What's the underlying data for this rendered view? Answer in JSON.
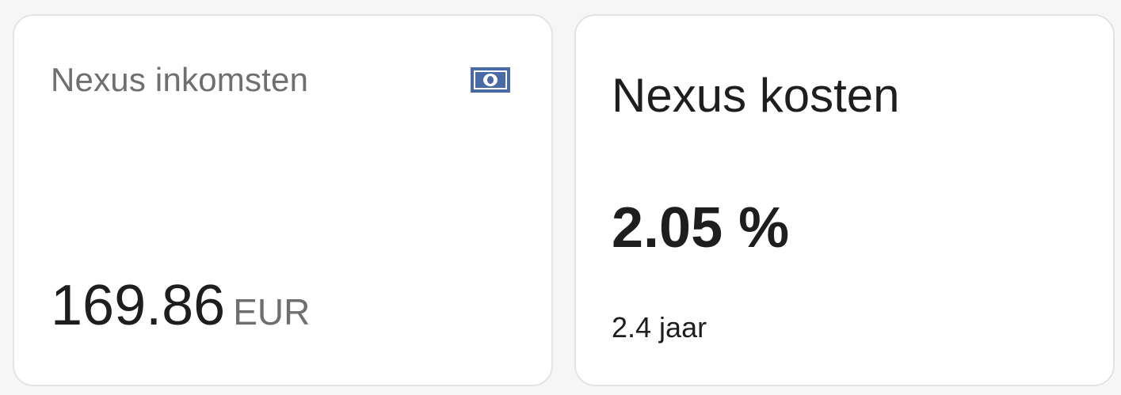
{
  "cards": {
    "income": {
      "title": "Nexus inkomsten",
      "icon": "cash-icon",
      "icon_color": "#4a6aa5",
      "value": "169.86",
      "unit": "EUR"
    },
    "cost": {
      "title": "Nexus kosten",
      "value": "2.05 %",
      "subtitle": "2.4 jaar"
    }
  }
}
